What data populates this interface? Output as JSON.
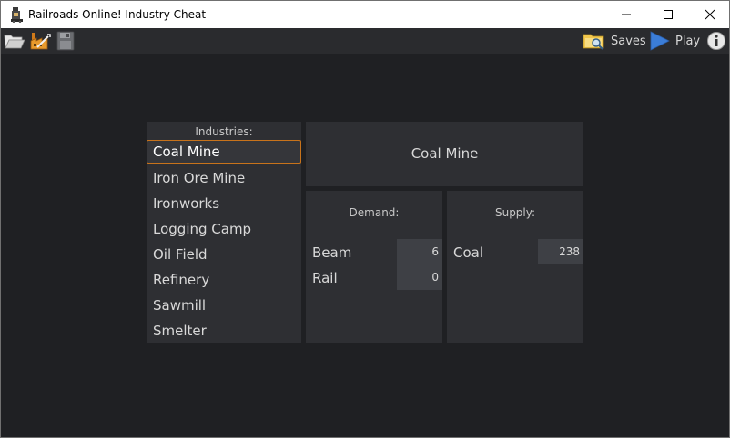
{
  "window": {
    "title": "Railroads Online! Industry Cheat"
  },
  "toolbar": {
    "open_icon": "folder-open-icon",
    "industry_icon": "factory-icon",
    "save_icon": "floppy-disk-icon",
    "saves_label": "Saves",
    "play_label": "Play",
    "info_icon": "info-icon"
  },
  "industries": {
    "heading": "Industries:",
    "selected_index": 0,
    "items": [
      {
        "label": "Coal Mine"
      },
      {
        "label": "Iron Ore Mine"
      },
      {
        "label": "Ironworks"
      },
      {
        "label": "Logging Camp"
      },
      {
        "label": "Oil Field"
      },
      {
        "label": "Refinery"
      },
      {
        "label": "Sawmill"
      },
      {
        "label": "Smelter"
      }
    ]
  },
  "detail": {
    "name": "Coal Mine",
    "demand": {
      "heading": "Demand:",
      "rows": [
        {
          "label": "Beam",
          "value": "6"
        },
        {
          "label": "Rail",
          "value": "0"
        }
      ]
    },
    "supply": {
      "heading": "Supply:",
      "rows": [
        {
          "label": "Coal",
          "value": "238"
        }
      ]
    }
  },
  "colors": {
    "accent_selected_border": "#c8731b",
    "background": "#1f2023",
    "panel": "#2e2f33"
  }
}
